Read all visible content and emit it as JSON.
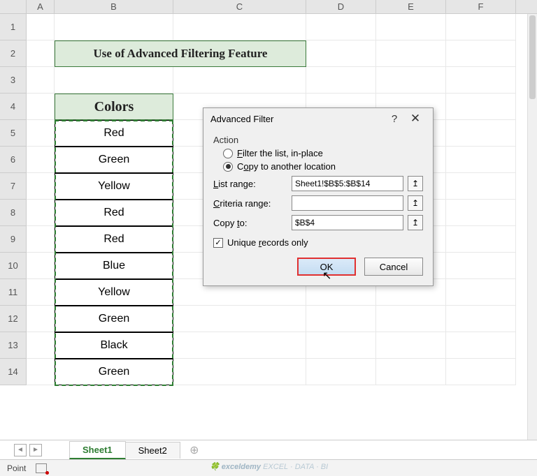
{
  "columns": [
    "A",
    "B",
    "C",
    "D",
    "E",
    "F"
  ],
  "rows": [
    "1",
    "2",
    "3",
    "4",
    "5",
    "6",
    "7",
    "8",
    "9",
    "10",
    "11",
    "12",
    "13",
    "14"
  ],
  "title_cell": "Use of Advanced Filtering Feature",
  "header_cell": "Colors",
  "data_values": [
    "Red",
    "Green",
    "Yellow",
    "Red",
    "Red",
    "Blue",
    "Yellow",
    "Green",
    "Black",
    "Green"
  ],
  "dialog": {
    "title": "Advanced Filter",
    "help": "?",
    "close": "✕",
    "action_label": "Action",
    "radio1": "Filter the list, in-place",
    "radio2": "Copy to another location",
    "list_range_label": "List range:",
    "list_range_value": "Sheet1!$B$5:$B$14",
    "criteria_label": "Criteria range:",
    "criteria_value": "",
    "copyto_label": "Copy to:",
    "copyto_value": "$B$4",
    "unique_label": "Unique records only",
    "ok": "OK",
    "cancel": "Cancel"
  },
  "tabs": {
    "sheet1": "Sheet1",
    "sheet2": "Sheet2"
  },
  "status": {
    "mode": "Point"
  },
  "watermark": {
    "brand": "exceldemy",
    "tag": " EXCEL · DATA · BI"
  }
}
